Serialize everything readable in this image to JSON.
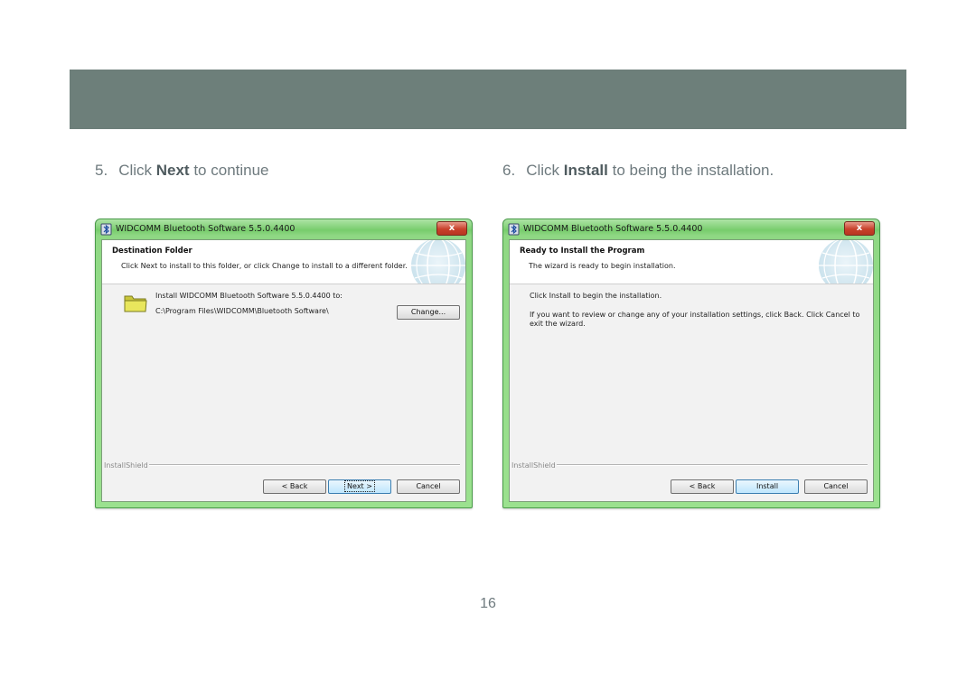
{
  "steps": {
    "step5": {
      "number": "5.",
      "pre": "Click ",
      "bold": "Next",
      "post": " to continue"
    },
    "step6": {
      "number": "6.",
      "pre": "Click ",
      "bold": "Install",
      "post": " to being the installation."
    }
  },
  "dialog_left": {
    "title": "WIDCOMM Bluetooth Software 5.5.0.4400",
    "close_label": "x",
    "header_title": "Destination Folder",
    "header_subtitle": "Click Next to install to this folder, or click Change to install to a different folder.",
    "install_line": "Install WIDCOMM Bluetooth Software 5.5.0.4400 to:",
    "path": "C:\\Program Files\\WIDCOMM\\Bluetooth Software\\",
    "change_button": "Change...",
    "installshield": "InstallShield",
    "back_button": "< Back",
    "next_button": "Next >",
    "cancel_button": "Cancel"
  },
  "dialog_right": {
    "title": "WIDCOMM Bluetooth Software 5.5.0.4400",
    "close_label": "x",
    "header_title": "Ready to Install the Program",
    "header_subtitle": "The wizard is ready to begin installation.",
    "line1": "Click Install to begin the installation.",
    "line2": "If you want to review or change any of your installation settings, click Back. Click Cancel to",
    "line3": "exit the wizard.",
    "installshield": "InstallShield",
    "back_button": "< Back",
    "install_button": "Install",
    "cancel_button": "Cancel"
  },
  "icons": [
    "app-icon",
    "close-icon",
    "folder-icon",
    "globe-icon"
  ],
  "colors": {
    "banner": "#6d7f7a",
    "window_frame": "#8fd884",
    "close_button": "#c8412c",
    "focus_button": "#bee6fd"
  },
  "page_number": "16"
}
